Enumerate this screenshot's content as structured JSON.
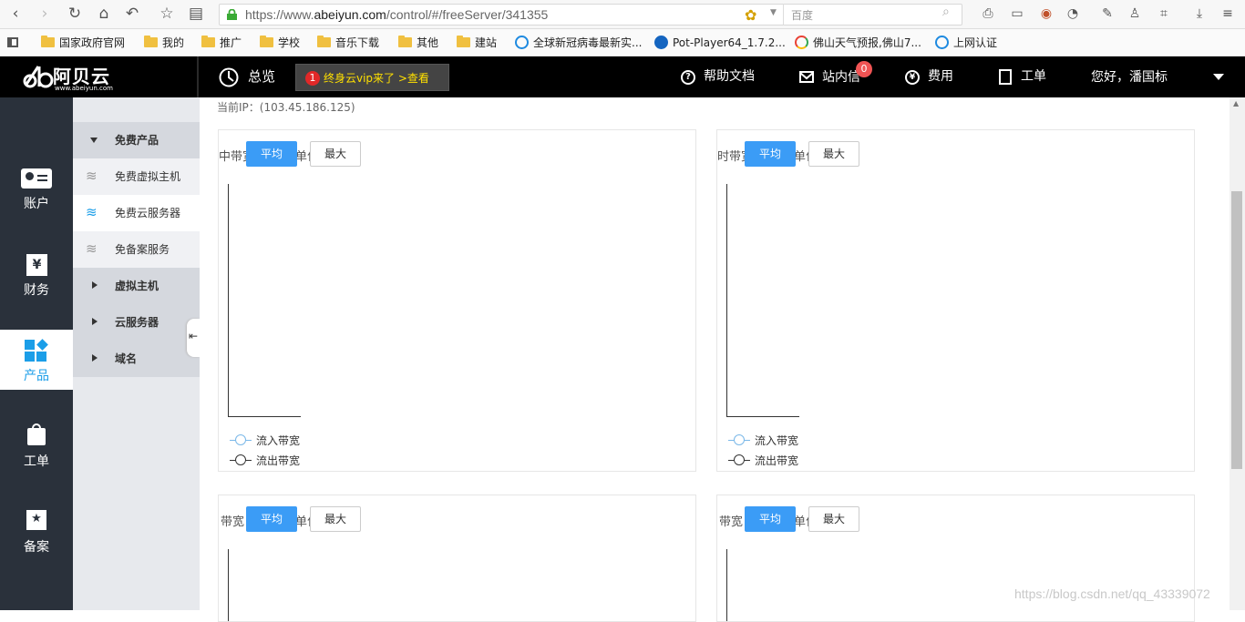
{
  "browser": {
    "url_prefix": "https://www.",
    "url_domain": "abeiyun.com",
    "url_path": "/control/#/freeServer/341355",
    "search_placeholder": "百度"
  },
  "bookmarks": [
    {
      "label": "国家政府官网",
      "icon": "folder-icon"
    },
    {
      "label": "我的",
      "icon": "folder-icon"
    },
    {
      "label": "推广",
      "icon": "folder-icon"
    },
    {
      "label": "学校",
      "icon": "folder-icon"
    },
    {
      "label": "音乐下载",
      "icon": "folder-icon"
    },
    {
      "label": "其他",
      "icon": "folder-icon"
    },
    {
      "label": "建站",
      "icon": "folder-icon"
    },
    {
      "label": "全球新冠病毒最新实...",
      "icon": "ie-icon"
    },
    {
      "label": "Pot-Player64_1.7.2...",
      "icon": "potplayer-icon"
    },
    {
      "label": "佛山天气预报,佛山7...",
      "icon": "chrome-icon"
    },
    {
      "label": "上网认证",
      "icon": "ie-icon"
    }
  ],
  "header": {
    "logo_text": "阿贝云",
    "logo_sub": "www.abeiyun.com",
    "overview": "总览",
    "promo_num": "1",
    "promo_text": "终身云vip来了  >查看",
    "help": "帮助文档",
    "messages": "站内信",
    "messages_badge": "0",
    "fees": "费用",
    "tickets": "工单",
    "greeting": "您好，潘国标"
  },
  "leftnav": [
    {
      "label": "账户",
      "icon": "account-card-icon"
    },
    {
      "label": "财务",
      "icon": "yen-icon"
    },
    {
      "label": "产品",
      "icon": "grid-diamond-icon",
      "active": true
    },
    {
      "label": "工单",
      "icon": "bag-icon"
    },
    {
      "label": "备案",
      "icon": "star-badge-icon"
    }
  ],
  "submenu": {
    "group_free": "免费产品",
    "free_vhost": "免费虚拟主机",
    "free_cloud": "免费云服务器",
    "free_icp": "免备案服务",
    "vhost": "虚拟主机",
    "cloud": "云服务器",
    "domain": "域名"
  },
  "main": {
    "ip_text": "当前IP：(103.45.186.125)",
    "btn_avg": "平均",
    "btn_max": "最大",
    "panels": [
      {
        "title_left": "中带宽",
        "title_right": "单位"
      },
      {
        "title_left": "时带宽",
        "title_right": "单位"
      },
      {
        "title_left": "带宽",
        "title_right": "单位"
      },
      {
        "title_left": "带宽",
        "title_right": "单位"
      }
    ],
    "legend_in": "流入带宽",
    "legend_out": "流出带宽",
    "legend_in_color": "#7ab8e8",
    "legend_out_color": "#333333"
  },
  "watermark": "https://blog.csdn.net/qq_43339072"
}
